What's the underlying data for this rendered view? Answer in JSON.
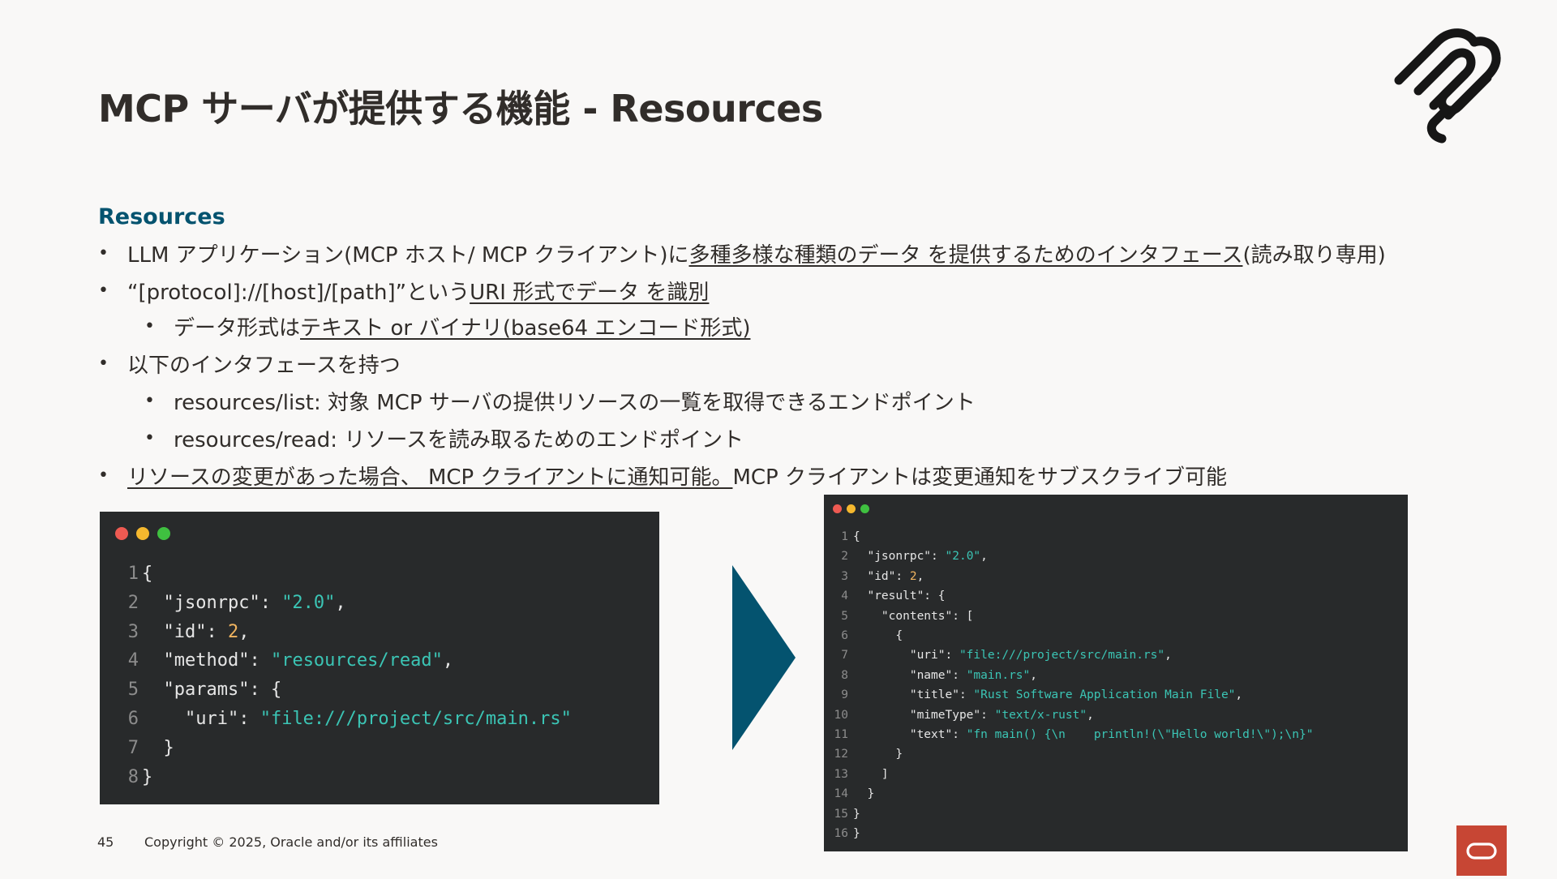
{
  "slide": {
    "title": "MCP サーバが提供する機能 - Resources",
    "section_heading": "Resources",
    "page_number": "45",
    "copyright": "Copyright © 2025, Oracle and/or its affiliates"
  },
  "bullets": [
    {
      "level": 1,
      "parts": [
        {
          "text": "LLM アプリケーション(MCP ホスト/ MCP クライアント)に",
          "u": false
        },
        {
          "text": "多種多様な種類のデータ を提供するためのインタフェース",
          "u": true
        },
        {
          "text": "(読み取り専用)",
          "u": false
        }
      ]
    },
    {
      "level": 1,
      "parts": [
        {
          "text": "“[protocol]://[host]/[path]”という",
          "u": false
        },
        {
          "text": " URI 形式でデータ を識別",
          "u": true
        }
      ]
    },
    {
      "level": 2,
      "parts": [
        {
          "text": "データ形式は",
          "u": false
        },
        {
          "text": "テキスト or バイナリ(base64 エンコード形式)",
          "u": true
        }
      ]
    },
    {
      "level": 1,
      "parts": [
        {
          "text": "以下のインタフェースを持つ",
          "u": false
        }
      ]
    },
    {
      "level": 2,
      "parts": [
        {
          "text": "resources/list: 対象 MCP サーバの提供リソースの一覧を取得できるエンドポイント",
          "u": false
        }
      ]
    },
    {
      "level": 2,
      "parts": [
        {
          "text": "resources/read: リソースを読み取るためのエンドポイント",
          "u": false
        }
      ]
    },
    {
      "level": 1,
      "parts": [
        {
          "text": "リソースの変更があった場合、 MCP クライアントに通知可能。 ",
          "u": true
        },
        {
          "text": "MCP クライアントは変更通知をサブスクライブ可能",
          "u": false
        }
      ]
    }
  ],
  "code_request": {
    "lines": [
      {
        "n": "1",
        "tokens": [
          {
            "t": "{",
            "c": "p"
          }
        ]
      },
      {
        "n": "2",
        "tokens": [
          {
            "t": "  \"jsonrpc\": ",
            "c": "p"
          },
          {
            "t": "\"2.0\"",
            "c": "s"
          },
          {
            "t": ",",
            "c": "p"
          }
        ]
      },
      {
        "n": "3",
        "tokens": [
          {
            "t": "  \"id\": ",
            "c": "p"
          },
          {
            "t": "2",
            "c": "n"
          },
          {
            "t": ",",
            "c": "p"
          }
        ]
      },
      {
        "n": "4",
        "tokens": [
          {
            "t": "  \"method\": ",
            "c": "p"
          },
          {
            "t": "\"resources/read\"",
            "c": "s"
          },
          {
            "t": ",",
            "c": "p"
          }
        ]
      },
      {
        "n": "5",
        "tokens": [
          {
            "t": "  \"params\": {",
            "c": "p"
          }
        ]
      },
      {
        "n": "6",
        "tokens": [
          {
            "t": "    \"uri\": ",
            "c": "p"
          },
          {
            "t": "\"file:///project/src/main.rs\"",
            "c": "s"
          }
        ]
      },
      {
        "n": "7",
        "tokens": [
          {
            "t": "  }",
            "c": "p"
          }
        ]
      },
      {
        "n": "8",
        "tokens": [
          {
            "t": "}",
            "c": "p"
          }
        ]
      }
    ]
  },
  "code_response": {
    "lines": [
      {
        "n": "1",
        "tokens": [
          {
            "t": "{",
            "c": "p"
          }
        ]
      },
      {
        "n": "2",
        "tokens": [
          {
            "t": "  \"jsonrpc\": ",
            "c": "p"
          },
          {
            "t": "\"2.0\"",
            "c": "s"
          },
          {
            "t": ",",
            "c": "p"
          }
        ]
      },
      {
        "n": "3",
        "tokens": [
          {
            "t": "  \"id\": ",
            "c": "p"
          },
          {
            "t": "2",
            "c": "n"
          },
          {
            "t": ",",
            "c": "p"
          }
        ]
      },
      {
        "n": "4",
        "tokens": [
          {
            "t": "  \"result\": {",
            "c": "p"
          }
        ]
      },
      {
        "n": "5",
        "tokens": [
          {
            "t": "    \"contents\": [",
            "c": "p"
          }
        ]
      },
      {
        "n": "6",
        "tokens": [
          {
            "t": "      {",
            "c": "p"
          }
        ]
      },
      {
        "n": "7",
        "tokens": [
          {
            "t": "        \"uri\": ",
            "c": "p"
          },
          {
            "t": "\"file:///project/src/main.rs\"",
            "c": "s"
          },
          {
            "t": ",",
            "c": "p"
          }
        ]
      },
      {
        "n": "8",
        "tokens": [
          {
            "t": "        \"name\": ",
            "c": "p"
          },
          {
            "t": "\"main.rs\"",
            "c": "s"
          },
          {
            "t": ",",
            "c": "p"
          }
        ]
      },
      {
        "n": "9",
        "tokens": [
          {
            "t": "        \"title\": ",
            "c": "p"
          },
          {
            "t": "\"Rust Software Application Main File\"",
            "c": "s"
          },
          {
            "t": ",",
            "c": "p"
          }
        ]
      },
      {
        "n": "10",
        "tokens": [
          {
            "t": "        \"mimeType\": ",
            "c": "p"
          },
          {
            "t": "\"text/x-rust\"",
            "c": "s"
          },
          {
            "t": ",",
            "c": "p"
          }
        ]
      },
      {
        "n": "11",
        "tokens": [
          {
            "t": "        \"text\": ",
            "c": "p"
          },
          {
            "t": "\"fn main() {\\n    println!(\\\"Hello world!\\\");\\n}\"",
            "c": "s"
          }
        ]
      },
      {
        "n": "12",
        "tokens": [
          {
            "t": "      }",
            "c": "p"
          }
        ]
      },
      {
        "n": "13",
        "tokens": [
          {
            "t": "    ]",
            "c": "p"
          }
        ]
      },
      {
        "n": "14",
        "tokens": [
          {
            "t": "  }",
            "c": "p"
          }
        ]
      },
      {
        "n": "15",
        "tokens": [
          {
            "t": "}",
            "c": "p"
          }
        ]
      },
      {
        "n": "16",
        "tokens": [
          {
            "t": "}",
            "c": "p"
          }
        ]
      }
    ]
  },
  "window_lights": [
    "#ee5a52",
    "#f5b82e",
    "#3fc040"
  ],
  "colors": {
    "background": "#f9f8f7",
    "text": "#312d2a",
    "accent_teal": "#04536f",
    "code_background": "#282a2b",
    "code_string": "#3bc5b5",
    "code_number": "#f0b460",
    "oracle_red": "#c74634"
  },
  "icons": {
    "brand": "mcp-logo-icon",
    "arrow": "right-arrow-icon",
    "footer": "oracle-logo-icon"
  }
}
